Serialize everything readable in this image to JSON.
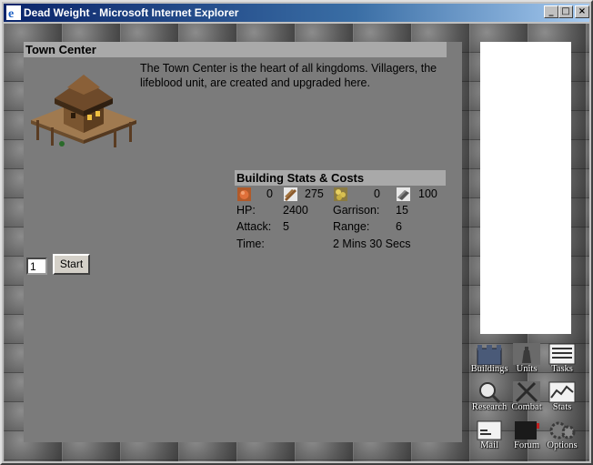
{
  "window": {
    "title": "Dead Weight - Microsoft Internet Explorer",
    "min_glyph": "_",
    "max_glyph": "□",
    "close_glyph": "×"
  },
  "building": {
    "name": "Town Center",
    "description": "The Town Center is the heart of all kingdoms. Villagers, the lifeblood unit, are created and upgraded here.",
    "image_icon": "town-center-building"
  },
  "stats": {
    "header": "Building Stats & Costs",
    "costs": [
      {
        "icon": "food-icon",
        "value": "0"
      },
      {
        "icon": "wood-icon",
        "value": "275"
      },
      {
        "icon": "gold-icon",
        "value": "0"
      },
      {
        "icon": "stone-icon",
        "value": "100"
      }
    ],
    "hp_label": "HP:",
    "hp_value": "2400",
    "garrison_label": "Garrison:",
    "garrison_value": "15",
    "attack_label": "Attack:",
    "attack_value": "5",
    "range_label": "Range:",
    "range_value": "6",
    "time_label": "Time:",
    "time_value": "2 Mins 30 Secs"
  },
  "build": {
    "quantity": "1",
    "start_label": "Start"
  },
  "nav": [
    {
      "label": "Buildings",
      "icon": "castle-icon"
    },
    {
      "label": "Units",
      "icon": "knight-icon"
    },
    {
      "label": "Tasks",
      "icon": "list-icon"
    },
    {
      "label": "Research",
      "icon": "magnifier-icon"
    },
    {
      "label": "Combat",
      "icon": "crossed-swords-icon"
    },
    {
      "label": "Stats",
      "icon": "chart-icon"
    },
    {
      "label": "Mail",
      "icon": "envelope-icon"
    },
    {
      "label": "Forum",
      "icon": "mailbox-icon"
    },
    {
      "label": "Options",
      "icon": "gears-icon"
    }
  ]
}
